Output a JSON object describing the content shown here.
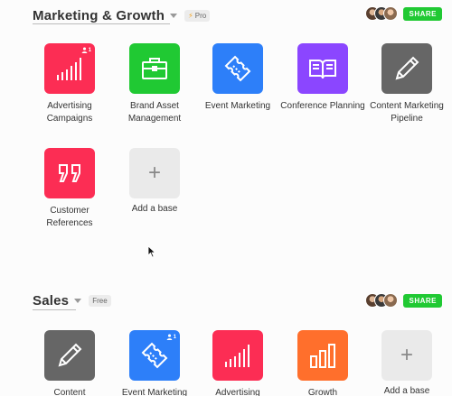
{
  "workspaces": [
    {
      "name": "Marketing & Growth",
      "plan": "Pro",
      "share_label": "SHARE",
      "bases": [
        {
          "name": "Advertising Campaigns",
          "color": "#fc2d54",
          "icon": "bar-chart-icon",
          "collaborators": "1"
        },
        {
          "name": "Brand Asset Management",
          "color": "#20c933",
          "icon": "briefcase-icon",
          "collaborators": ""
        },
        {
          "name": "Event Marketing",
          "color": "#2d7ff9",
          "icon": "ticket-icon",
          "collaborators": ""
        },
        {
          "name": "Conference Planning",
          "color": "#8b46ff",
          "icon": "book-icon",
          "collaborators": ""
        },
        {
          "name": "Content Marketing Pipeline",
          "color": "#666666",
          "icon": "pencil-icon",
          "collaborators": ""
        },
        {
          "name": "Customer References",
          "color": "#fc2d54",
          "icon": "quote-icon",
          "collaborators": ""
        }
      ],
      "add_label": "Add a base"
    },
    {
      "name": "Sales",
      "plan": "Free",
      "share_label": "SHARE",
      "bases": [
        {
          "name": "Content",
          "color": "#666666",
          "icon": "pencil-icon",
          "collaborators": ""
        },
        {
          "name": "Event Marketing",
          "color": "#2d7ff9",
          "icon": "ticket-icon",
          "collaborators": "1"
        },
        {
          "name": "Advertising",
          "color": "#fc2d54",
          "icon": "bar-chart-icon",
          "collaborators": ""
        },
        {
          "name": "Growth",
          "color": "#ff6f2c",
          "icon": "bar-chart-outline-icon",
          "collaborators": ""
        }
      ],
      "add_label": "Add a base"
    }
  ]
}
